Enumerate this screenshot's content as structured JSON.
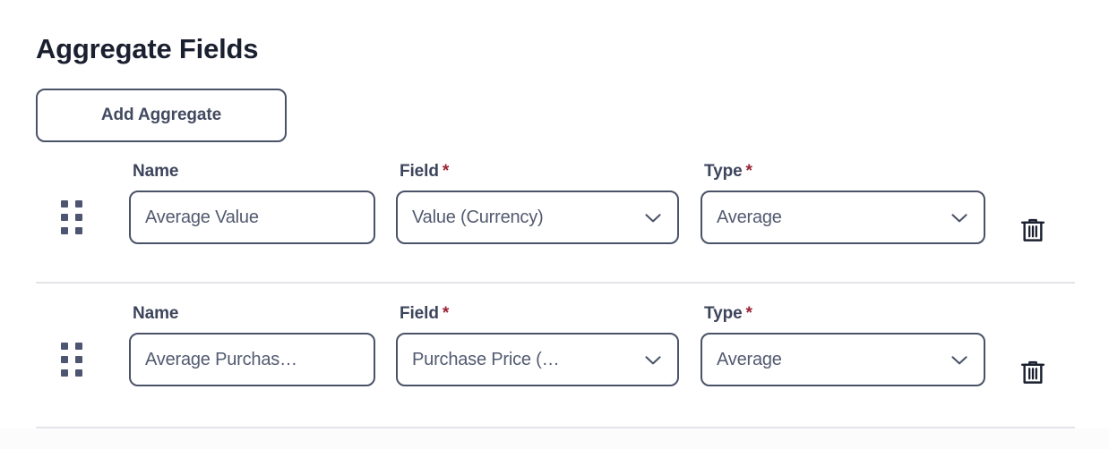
{
  "header": {
    "title": "Aggregate Fields"
  },
  "toolbar": {
    "add_aggregate_label": "Add Aggregate"
  },
  "labels": {
    "name": "Name",
    "field": "Field",
    "type": "Type",
    "required_marker": "*"
  },
  "colors": {
    "border": "#4a5268",
    "label_text": "#3d455c",
    "value_text": "#525a70",
    "required_star": "#9b2335",
    "title": "#1b2030",
    "divider": "#e3e4e8",
    "page_background": "#ffffff"
  },
  "icons": {
    "drag_handle": "drag-handle-icon",
    "chevron_down": "chevron-down-icon",
    "trash": "trash-icon"
  },
  "rows": [
    {
      "name_value": "Average Value",
      "name_placeholder": "Name",
      "field_value": "Value (Currency)",
      "type_value": "Average"
    },
    {
      "name_value": "Average Purchas…",
      "name_placeholder": "Name",
      "field_value": "Purchase Price (…",
      "type_value": "Average"
    }
  ]
}
